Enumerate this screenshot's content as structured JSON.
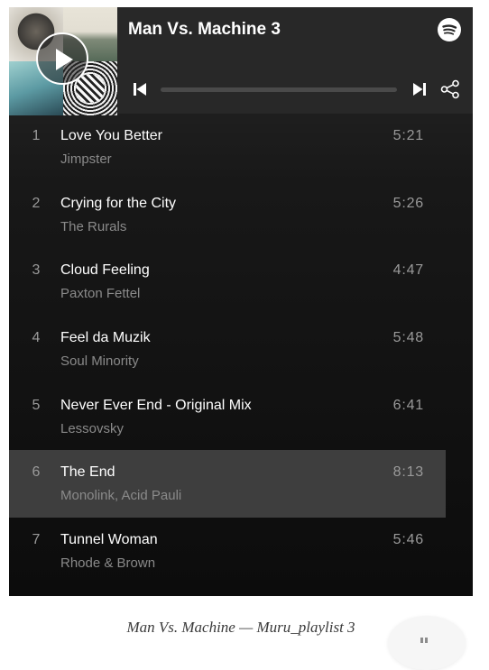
{
  "player": {
    "title": "Man Vs. Machine 3",
    "icons": {
      "play": "play-icon",
      "brand": "spotify-icon",
      "previous": "skip-previous-icon",
      "next": "skip-next-icon",
      "share": "share-icon"
    },
    "progress": 0
  },
  "tracks": [
    {
      "number": "1",
      "name": "Love You Better",
      "artist": "Jimpster",
      "duration": "5:21"
    },
    {
      "number": "2",
      "name": "Crying for the City",
      "artist": "The Rurals",
      "duration": "5:26"
    },
    {
      "number": "3",
      "name": "Cloud Feeling",
      "artist": "Paxton Fettel",
      "duration": "4:47"
    },
    {
      "number": "4",
      "name": "Feel da Muzik",
      "artist": "Soul Minority",
      "duration": "5:48"
    },
    {
      "number": "5",
      "name": "Never Ever End - Original Mix",
      "artist": "Lessovsky",
      "duration": "6:41"
    },
    {
      "number": "6",
      "name": "The End",
      "artist": "Monolink, Acid Pauli",
      "duration": "8:13",
      "active": true
    },
    {
      "number": "7",
      "name": "Tunnel Woman",
      "artist": "Rhode & Brown",
      "duration": "5:46"
    }
  ],
  "caption": "Man Vs. Machine — Muru_playlist 3",
  "colors": {
    "player_bg": "#181818",
    "header_bg": "#282828",
    "active_row": "#3e3e3e",
    "text_primary": "#ffffff",
    "text_secondary": "#8a8a8a"
  }
}
